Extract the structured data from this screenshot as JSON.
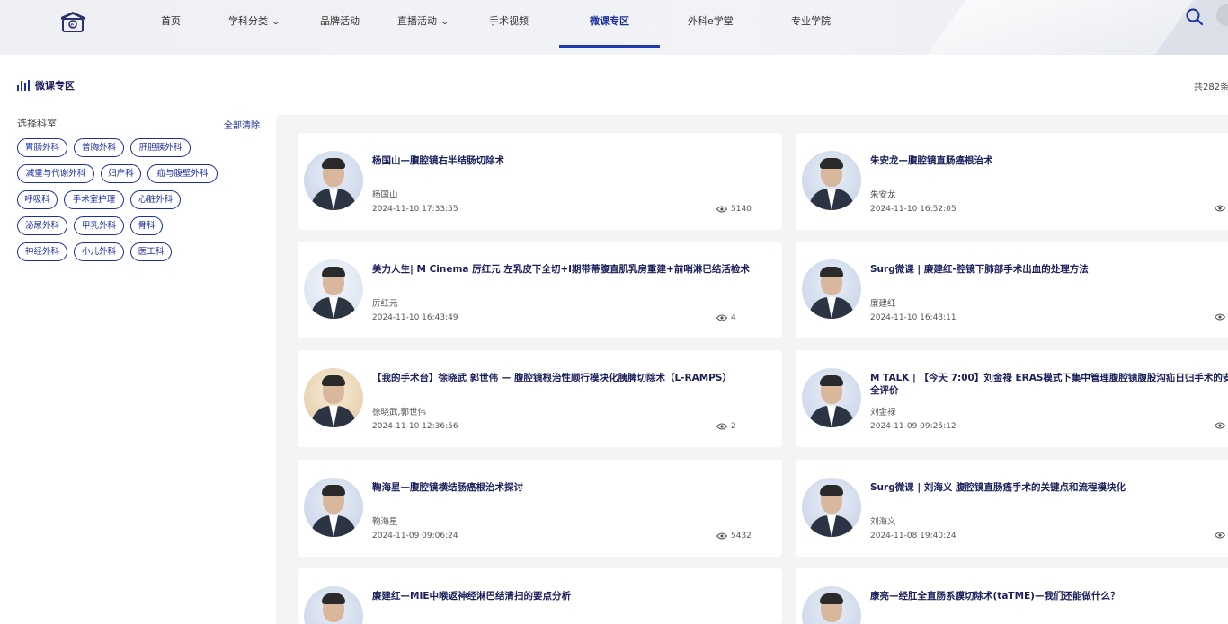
{
  "nav": {
    "items": [
      {
        "label": "首页",
        "dropdown": false,
        "active": false
      },
      {
        "label": "学科分类",
        "dropdown": true,
        "active": false
      },
      {
        "label": "品牌活动",
        "dropdown": false,
        "active": false
      },
      {
        "label": "直播活动",
        "dropdown": true,
        "active": false
      },
      {
        "label": "手术视频",
        "dropdown": false,
        "active": false
      },
      {
        "label": "微课专区",
        "dropdown": false,
        "active": true
      },
      {
        "label": "外科e学堂",
        "dropdown": false,
        "active": false
      },
      {
        "label": "专业学院",
        "dropdown": false,
        "active": false
      }
    ],
    "chevron": "⌄"
  },
  "section": {
    "title": "微课专区",
    "total": "共282条"
  },
  "filter": {
    "label": "选择科室",
    "clear_label": "全部清除",
    "tags": [
      "胃肠外科",
      "普胸外科",
      "肝胆胰外科",
      "减重与代谢外科",
      "妇产科",
      "疝与腹壁外科",
      "呼吸科",
      "手术室护理",
      "心脏外科",
      "泌尿外科",
      "甲乳外科",
      "骨科",
      "神经外科",
      "小儿外科",
      "医工科"
    ]
  },
  "cards": [
    {
      "title": "杨国山—腹腔镜右半结肠切除术",
      "author": "杨国山",
      "date": "2024-11-10 17:33:55",
      "views": "5140"
    },
    {
      "title": "朱安龙—腹腔镜直肠癌根治术",
      "author": "朱安龙",
      "date": "2024-11-10 16:52:05",
      "views": ""
    },
    {
      "title": "美力人生| M Cinema 厉红元 左乳皮下全切+I期带蒂腹直肌乳房重建+前哨淋巴结活检术",
      "author": "厉红元",
      "date": "2024-11-10 16:43:49",
      "views": "4"
    },
    {
      "title": "Surg微课 | 廉建红-腔镜下肺部手术出血的处理方法",
      "author": "廉建红",
      "date": "2024-11-10 16:43:11",
      "views": ""
    },
    {
      "title": "【我的手术台】徐晓武 郭世伟 — 腹腔镜根治性顺行模块化胰脾切除术（L-RAMPS）",
      "author": "徐晓武,郭世伟",
      "date": "2024-11-10 12:36:56",
      "views": "2"
    },
    {
      "title": "M TALK | 【今天 7:00】刘金禄 ERAS模式下集中管理腹腔镜腹股沟疝日归手术的安全评价",
      "author": "刘金禄",
      "date": "2024-11-09 09:25:12",
      "views": ""
    },
    {
      "title": "鞠海星—腹腔镜横结肠癌根治术探讨",
      "author": "鞠海星",
      "date": "2024-11-09 09:06:24",
      "views": "5432"
    },
    {
      "title": "Surg微课 | 刘海义 腹腔镜直肠癌手术的关键点和流程模块化",
      "author": "刘海义",
      "date": "2024-11-08 19:40:24",
      "views": ""
    },
    {
      "title": "廉建红—MIE中喉返神经淋巴结清扫的要点分析",
      "author": "",
      "date": "",
      "views": ""
    },
    {
      "title": "康亮—经肛全直肠系膜切除术(taTME)—我们还能做什么？",
      "author": "",
      "date": "",
      "views": ""
    }
  ]
}
